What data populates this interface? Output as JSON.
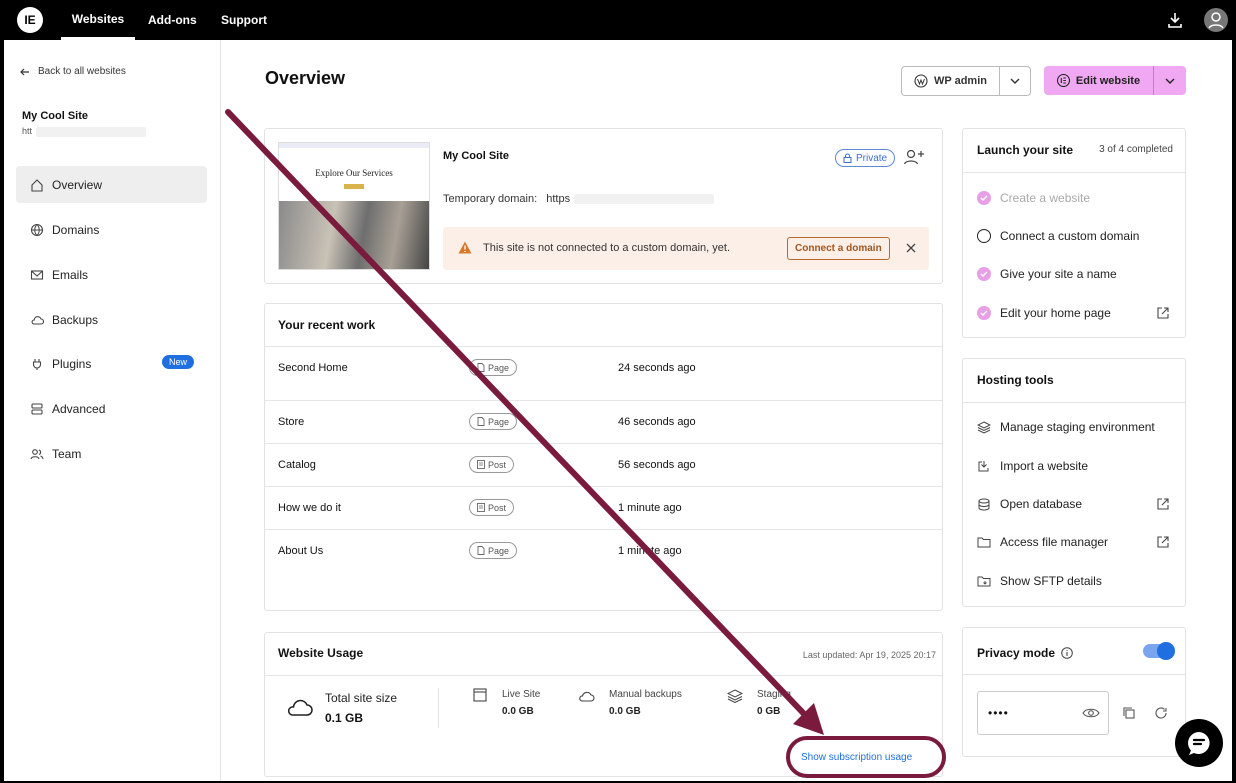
{
  "topbar": {
    "logo": "IE",
    "nav": [
      "Websites",
      "Add-ons",
      "Support"
    ],
    "icons": [
      "download-icon",
      "user-avatar-icon"
    ]
  },
  "sidebar": {
    "back_label": "Back to all websites",
    "site_name": "My Cool Site",
    "site_url": "htt",
    "items": [
      {
        "label": "Overview",
        "icon": "home-icon"
      },
      {
        "label": "Domains",
        "icon": "globe-icon"
      },
      {
        "label": "Emails",
        "icon": "mail-icon"
      },
      {
        "label": "Backups",
        "icon": "cloud-icon"
      },
      {
        "label": "Plugins",
        "icon": "plug-icon",
        "badge": "New"
      },
      {
        "label": "Advanced",
        "icon": "server-icon"
      },
      {
        "label": "Team",
        "icon": "people-icon"
      }
    ]
  },
  "header": {
    "title": "Overview",
    "wp_admin": "WP admin",
    "edit_website": "Edit website"
  },
  "site_card": {
    "name": "My Cool Site",
    "privacy_badge": "Private",
    "temp_domain_label": "Temporary domain:",
    "temp_domain_value": "https",
    "warning": "This site is not connected to a custom domain, yet.",
    "connect_label": "Connect a domain",
    "thumb_heading": "Explore Our Services"
  },
  "recent_work": {
    "title": "Your recent work",
    "rows": [
      {
        "name": "Second Home",
        "type": "Page",
        "when": "24 seconds ago"
      },
      {
        "name": "Store",
        "type": "Page",
        "when": "46 seconds ago"
      },
      {
        "name": "Catalog",
        "type": "Post",
        "when": "56 seconds ago"
      },
      {
        "name": "How we do it",
        "type": "Post",
        "when": "1 minute ago"
      },
      {
        "name": "About Us",
        "type": "Page",
        "when": "1 minute ago"
      }
    ]
  },
  "usage": {
    "title": "Website Usage",
    "last_updated": "Last updated: Apr 19, 2025 20:17",
    "total_label": "Total site size",
    "total_value": "0.1 GB",
    "stats": [
      {
        "label": "Live Site",
        "value": "0.0 GB"
      },
      {
        "label": "Manual backups",
        "value": "0.0 GB"
      },
      {
        "label": "Staging",
        "value": "0 GB"
      }
    ],
    "show_link": "Show subscription usage"
  },
  "launch": {
    "title": "Launch your site",
    "progress": "3 of 4 completed",
    "items": [
      {
        "label": "Create a website",
        "done": true
      },
      {
        "label": "Connect a custom domain",
        "done": false
      },
      {
        "label": "Give your site a name",
        "done": true
      },
      {
        "label": "Edit your home page",
        "done": true
      }
    ]
  },
  "hosting": {
    "title": "Hosting tools",
    "items": [
      {
        "label": "Manage staging environment",
        "icon": "layers-icon"
      },
      {
        "label": "Import a website",
        "icon": "import-icon"
      },
      {
        "label": "Open database",
        "icon": "database-icon"
      },
      {
        "label": "Access file manager",
        "icon": "folder-icon"
      },
      {
        "label": "Show SFTP details",
        "icon": "sftp-icon"
      }
    ]
  },
  "privacy": {
    "title": "Privacy mode",
    "password_mask": "••••",
    "enabled": true
  },
  "colors": {
    "accent": "#f0a8f2",
    "link": "#1f6fe0",
    "annotation": "#7a1b3e"
  }
}
